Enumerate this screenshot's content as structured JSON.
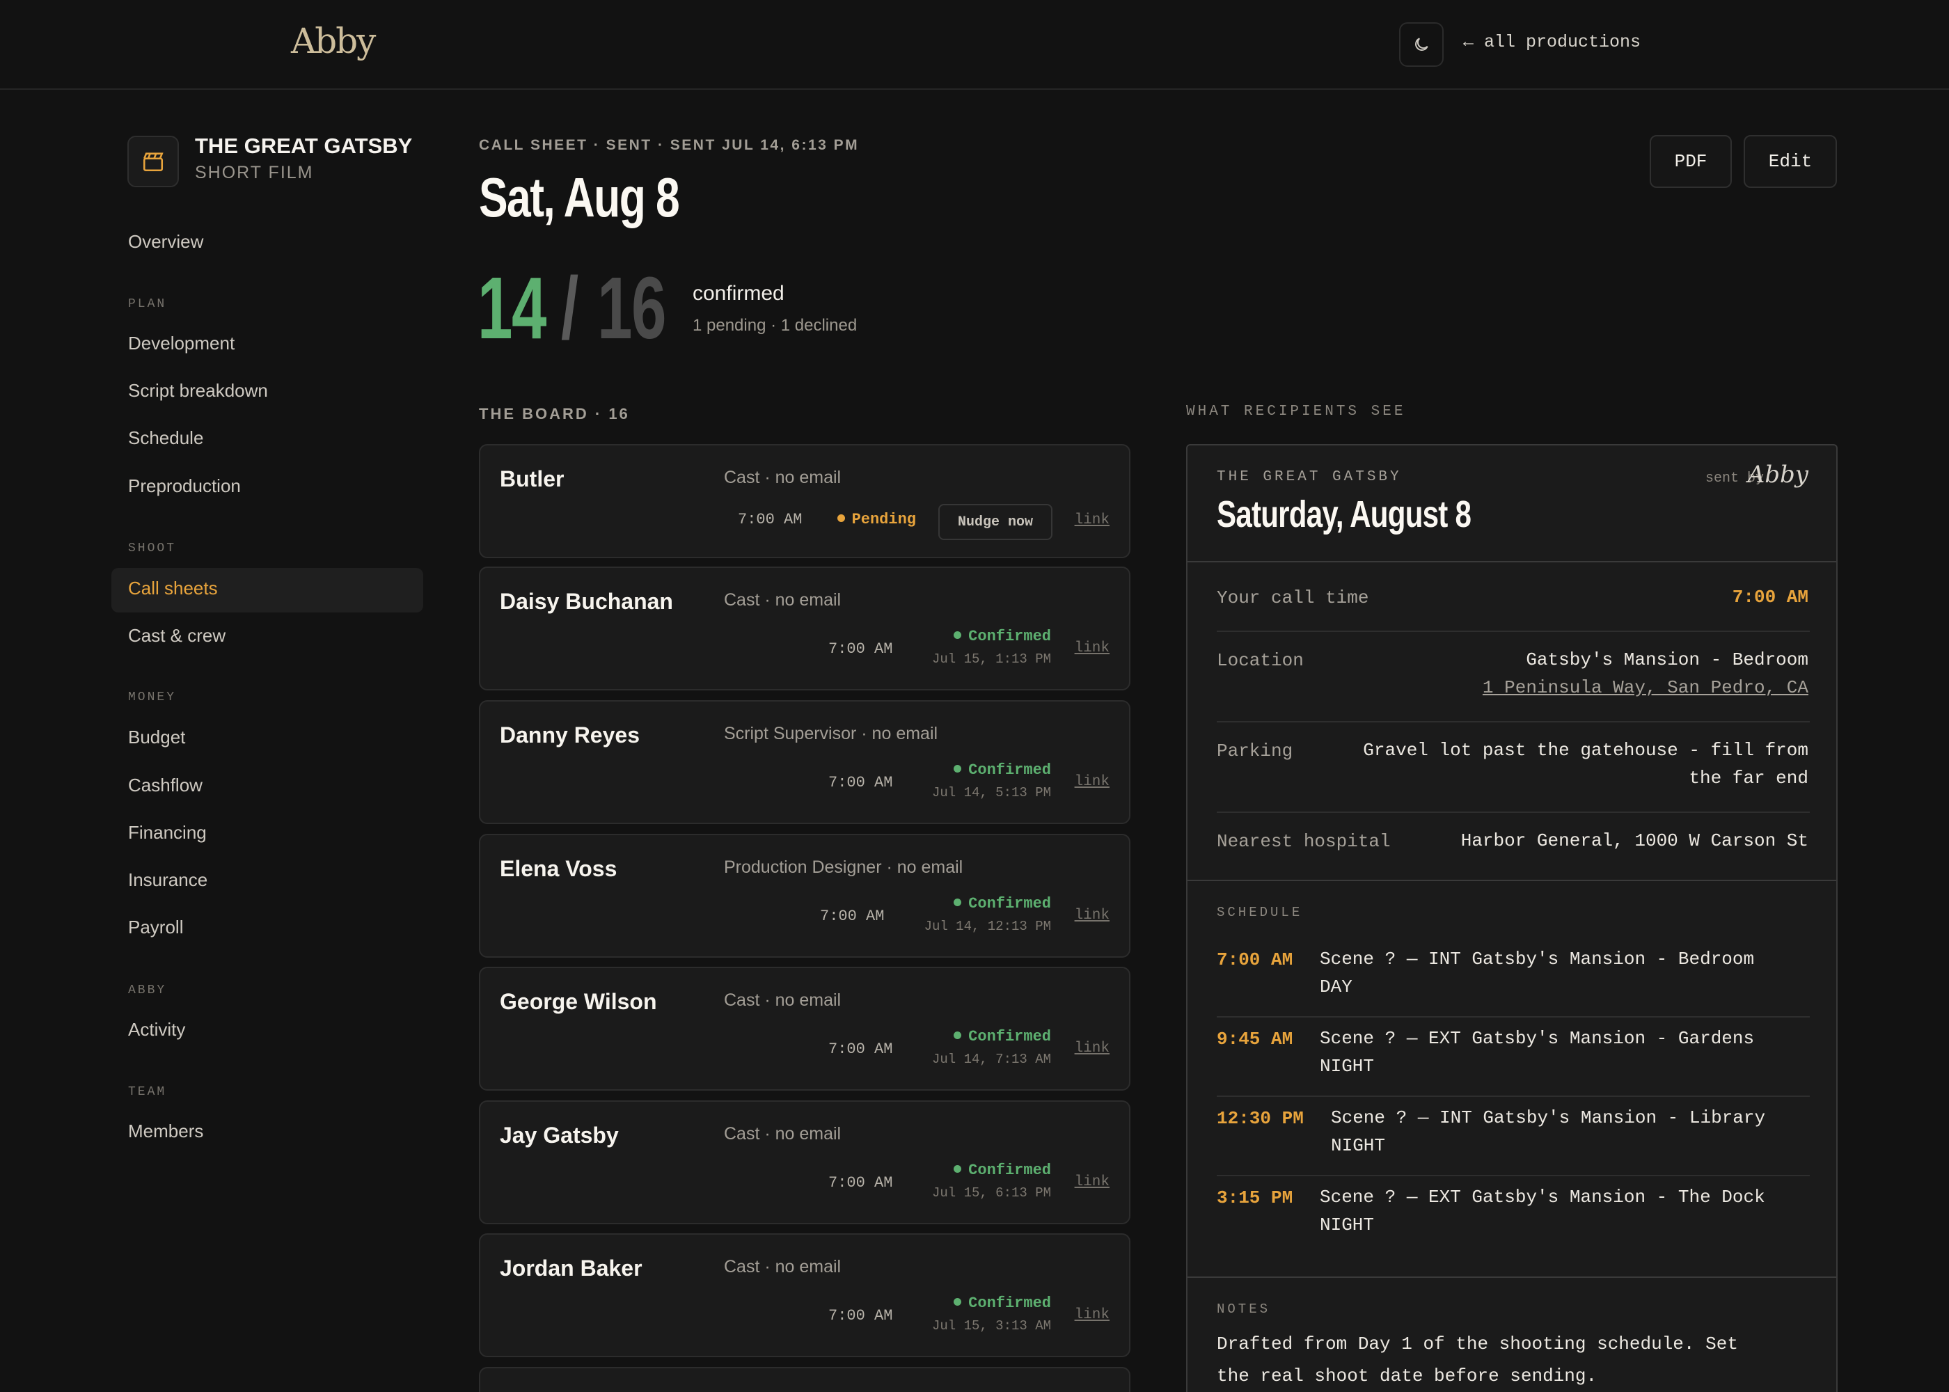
{
  "topbar": {
    "logo": "Abby",
    "back_label": "← all productions"
  },
  "production": {
    "title": "THE GREAT GATSBY",
    "subtitle": "SHORT FILM"
  },
  "nav": {
    "overview": "Overview",
    "plan": {
      "heading": "PLAN",
      "items": [
        "Development",
        "Script breakdown",
        "Schedule",
        "Preproduction"
      ]
    },
    "shoot": {
      "heading": "SHOOT",
      "items": [
        "Call sheets",
        "Cast & crew"
      ]
    },
    "money": {
      "heading": "MONEY",
      "items": [
        "Budget",
        "Cashflow",
        "Financing",
        "Insurance",
        "Payroll"
      ]
    },
    "abby": {
      "heading": "ABBY",
      "items": [
        "Activity"
      ]
    },
    "team": {
      "heading": "TEAM",
      "items": [
        "Members"
      ]
    },
    "active": "Call sheets"
  },
  "header": {
    "meta": "CALL SHEET · SENT · SENT JUL 14, 6:13 PM",
    "date": "Sat, Aug 8",
    "confirmed_count": "14",
    "slash": "/",
    "total": "16",
    "confirmed_label": "confirmed",
    "confirmed_sub": "1 pending · 1 declined",
    "pdf_label": "PDF",
    "edit_label": "Edit"
  },
  "board": {
    "title": "THE BOARD · 16",
    "link_label": "link",
    "nudge_label": "Nudge now",
    "rows": [
      {
        "name": "Butler",
        "role": "Cast · no email",
        "time": "7:00 AM",
        "status": "Pending",
        "stamp": ""
      },
      {
        "name": "Daisy Buchanan",
        "role": "Cast · no email",
        "time": "7:00 AM",
        "status": "Confirmed",
        "stamp": "Jul 15, 1:13 PM"
      },
      {
        "name": "Danny Reyes",
        "role": "Script Supervisor · no email",
        "time": "7:00 AM",
        "status": "Confirmed",
        "stamp": "Jul 14, 5:13 PM"
      },
      {
        "name": "Elena Voss",
        "role": "Production Designer · no email",
        "time": "7:00 AM",
        "status": "Confirmed",
        "stamp": "Jul 14, 12:13 PM"
      },
      {
        "name": "George Wilson",
        "role": "Cast · no email",
        "time": "7:00 AM",
        "status": "Confirmed",
        "stamp": "Jul 14, 7:13 AM"
      },
      {
        "name": "Jay Gatsby",
        "role": "Cast · no email",
        "time": "7:00 AM",
        "status": "Confirmed",
        "stamp": "Jul 15, 6:13 PM"
      },
      {
        "name": "Jordan Baker",
        "role": "Cast · no email",
        "time": "7:00 AM",
        "status": "Confirmed",
        "stamp": "Jul 15, 3:13 AM"
      }
    ]
  },
  "preview": {
    "heading": "WHAT RECIPIENTS SEE",
    "production": "THE GREAT GATSBY",
    "sent_by": "sent by",
    "sent_by_name": "Abby",
    "date": "Saturday, August 8",
    "call_time_label": "Your call time",
    "call_time": "7:00 AM",
    "location_label": "Location",
    "location_name": "Gatsby's Mansion - Bedroom",
    "location_address": "1 Peninsula Way, San Pedro, CA",
    "parking_label": "Parking",
    "parking_line1": "Gravel lot past the gatehouse - fill from",
    "parking_line2": "the far end",
    "hospital_label": "Nearest hospital",
    "hospital": "Harbor General, 1000 W Carson St",
    "schedule_heading": "SCHEDULE",
    "schedule": [
      {
        "time": "7:00 AM",
        "line1": "Scene ? — INT Gatsby's Mansion - Bedroom",
        "line2": "DAY"
      },
      {
        "time": "9:45 AM",
        "line1": "Scene ? — EXT Gatsby's Mansion - Gardens",
        "line2": "NIGHT"
      },
      {
        "time": "12:30 PM",
        "line1": "Scene ? — INT Gatsby's Mansion - Library",
        "line2": "NIGHT"
      },
      {
        "time": "3:15 PM",
        "line1": "Scene ? — EXT Gatsby's Mansion - The Dock",
        "line2": "NIGHT"
      }
    ],
    "notes_heading": "NOTES",
    "notes_line1": "Drafted from Day 1 of the shooting schedule. Set",
    "notes_line2": "the real shoot date before sending."
  },
  "colors": {
    "accent": "#e8a43c",
    "confirmed": "#5db070",
    "background": "#121212"
  },
  "icons": {
    "theme": "moon-icon",
    "production": "clapperboard-icon"
  }
}
